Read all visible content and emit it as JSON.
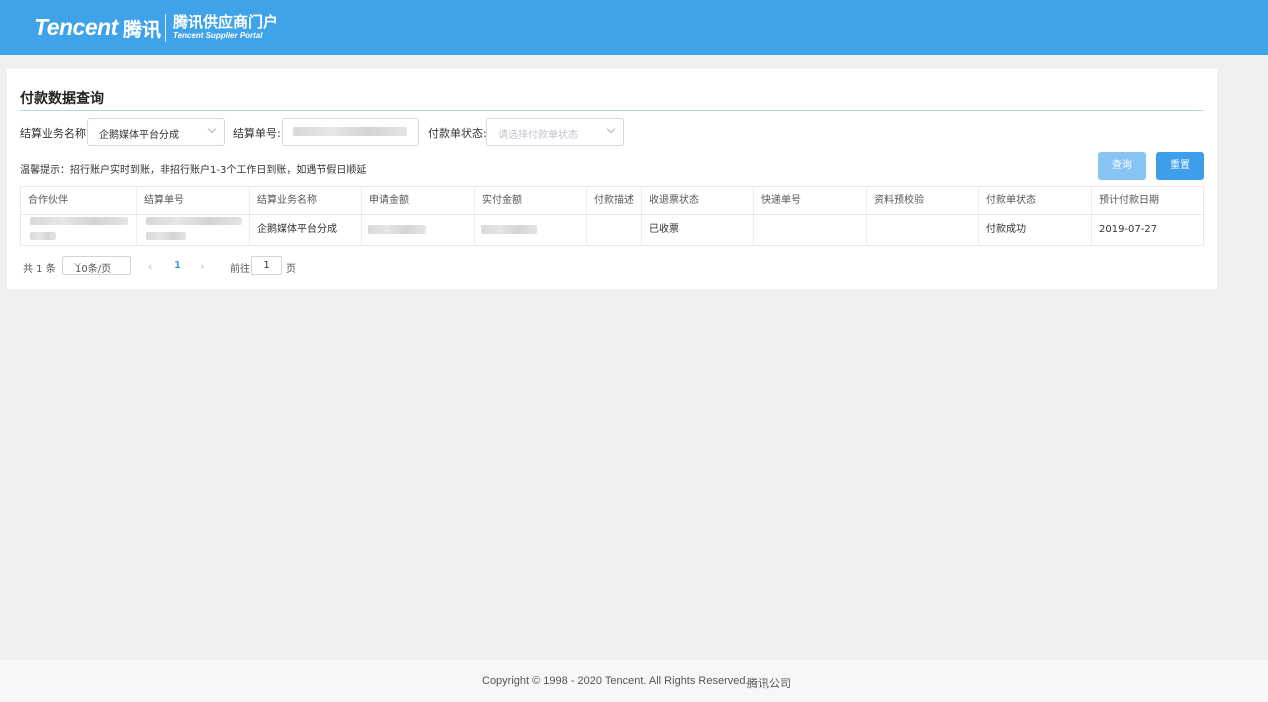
{
  "header": {
    "brand_en": "Tencent",
    "brand_cn": "腾讯",
    "portal_cn": "腾讯供应商门户",
    "portal_en": "Tencent Supplier Portal"
  },
  "page": {
    "title": "付款数据查询"
  },
  "filters": {
    "business_name_label": "结算业务名称:",
    "business_name_value": "企鹅媒体平台分成",
    "settlement_no_label": "结算单号:",
    "payment_status_label": "付款单状态:",
    "payment_status_placeholder": "请选择付款单状态"
  },
  "tip": "温馨提示：招行账户实时到账，非招行账户1-3个工作日到账，如遇节假日顺延",
  "buttons": {
    "query": "查询",
    "reset": "重置"
  },
  "table": {
    "headers": [
      "合作伙伴",
      "结算单号",
      "结算业务名称",
      "申请金额",
      "实付金额",
      "付款描述",
      "收退票状态",
      "快递单号",
      "资料预校验",
      "付款单状态",
      "预计付款日期"
    ],
    "rows": [
      {
        "business_name": "企鹅媒体平台分成",
        "invoice_status": "已收票",
        "payment_status": "付款成功",
        "expected_date": "2019-07-27"
      }
    ]
  },
  "pagination": {
    "total": "共 1 条",
    "page_size": "10条/页",
    "current_page": "1",
    "goto_label": "前往",
    "goto_value": "1",
    "page_suffix": "页"
  },
  "footer": {
    "copyright": "Copyright © 1998 - 2020 Tencent. All Rights Reserved.",
    "company": "腾讯公司"
  },
  "colors": {
    "header_bg": "#3fa3ea",
    "primary": "#3d9fea",
    "primary_light": "#86c4f3"
  }
}
